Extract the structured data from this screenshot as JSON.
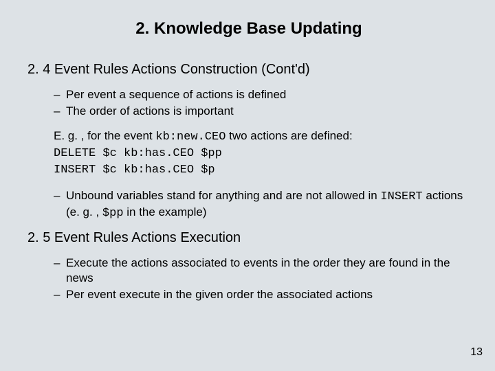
{
  "title": "2. Knowledge Base Updating",
  "section24": "2. 4 Event Rules Actions Construction (Cont'd)",
  "bullets24a": [
    "Per event a sequence of actions is defined",
    "The order of actions is important"
  ],
  "example": {
    "lead_a": "E. g. , for the event ",
    "lead_code": "kb:new.CEO",
    "lead_b": " two actions are defined:",
    "line1": "DELETE $c kb:has.CEO $pp",
    "line2": "INSERT $c kb:has.CEO $p"
  },
  "bullets24b": [
    {
      "pre": "Unbound variables stand for anything and are not allowed in ",
      "code1": "INSERT",
      "mid": " actions (e. g. , ",
      "code2": "$pp",
      "post": " in the example)"
    }
  ],
  "section25": "2. 5 Event Rules Actions Execution",
  "bullets25": [
    "Execute the actions associated to events in the order they are found in the news",
    "Per event execute in the given order the associated actions"
  ],
  "page": "13"
}
